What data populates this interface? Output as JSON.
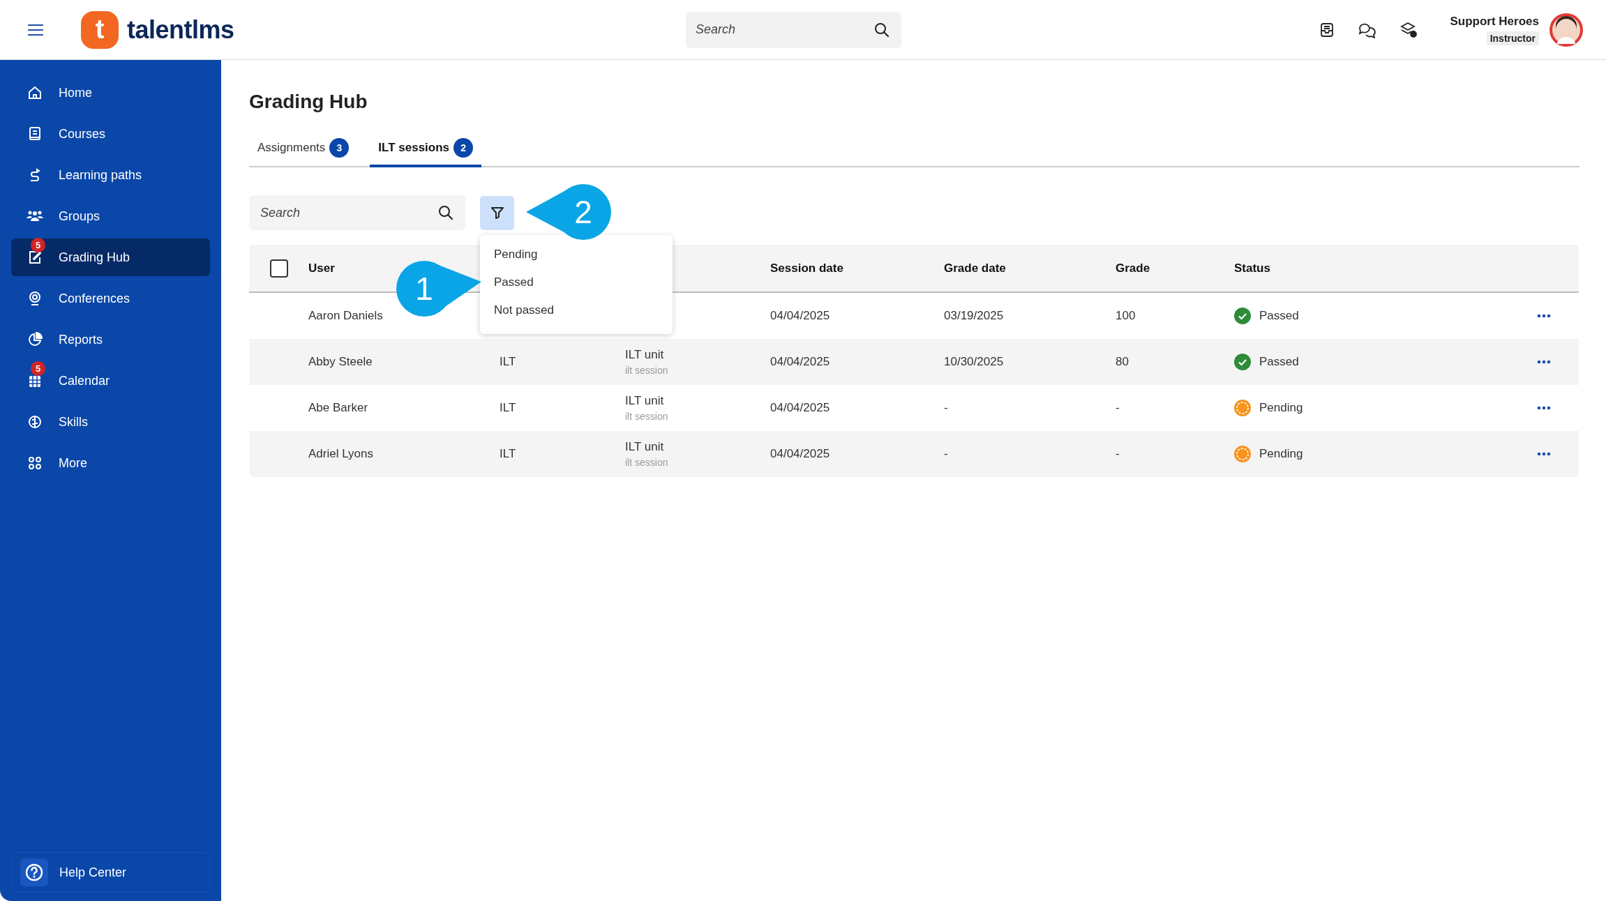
{
  "topbar": {
    "logo_mark": "t",
    "logo_text": "talentlms",
    "search": {
      "placeholder": "Search"
    },
    "user": {
      "name": "Support Heroes",
      "role": "Instructor"
    }
  },
  "sidebar": {
    "items": [
      {
        "label": "Home",
        "selected": false
      },
      {
        "label": "Courses",
        "selected": false
      },
      {
        "label": "Learning paths",
        "selected": false
      },
      {
        "label": "Groups",
        "selected": false
      },
      {
        "label": "Grading Hub",
        "selected": true,
        "badge": "5"
      },
      {
        "label": "Conferences",
        "selected": false
      },
      {
        "label": "Reports",
        "selected": false
      },
      {
        "label": "Calendar",
        "selected": false,
        "badge": "5"
      },
      {
        "label": "Skills",
        "selected": false
      },
      {
        "label": "More",
        "selected": false
      }
    ],
    "help": {
      "label": "Help Center"
    }
  },
  "page": {
    "title": "Grading Hub",
    "tabs": [
      {
        "label": "Assignments",
        "count": "3",
        "selected": false
      },
      {
        "label": "ILT sessions",
        "count": "2",
        "selected": true
      }
    ],
    "search": {
      "placeholder": "Search"
    },
    "filter_menu": {
      "options": [
        "Pending",
        "Passed",
        "Not passed"
      ]
    },
    "callouts": [
      {
        "label": "1"
      },
      {
        "label": "2"
      }
    ],
    "table": {
      "select_all": {
        "checked": false
      },
      "columns": [
        "User",
        "Session date",
        "Grade date",
        "Grade",
        "Status"
      ],
      "rows": [
        {
          "user": "Aaron Daniels",
          "session_date": "04/04/2025",
          "grade_date": "03/19/2025",
          "grade": "100",
          "status": {
            "label": "Passed",
            "kind": "passed"
          }
        },
        {
          "user": "Abby Steele",
          "type": "ILT",
          "unit": "ILT unit",
          "unit_sub": "ilt session",
          "session_date": "04/04/2025",
          "grade_date": "10/30/2025",
          "grade": "80",
          "status": {
            "label": "Passed",
            "kind": "passed"
          }
        },
        {
          "user": "Abe Barker",
          "type": "ILT",
          "unit": "ILT unit",
          "unit_sub": "ilt session",
          "session_date": "04/04/2025",
          "grade_date": "-",
          "grade": "-",
          "status": {
            "label": "Pending",
            "kind": "pending"
          }
        },
        {
          "user": "Adriel Lyons",
          "type": "ILT",
          "unit": "ILT unit",
          "unit_sub": "ilt session",
          "session_date": "04/04/2025",
          "grade_date": "-",
          "grade": "-",
          "status": {
            "label": "Pending",
            "kind": "pending"
          }
        }
      ]
    }
  }
}
